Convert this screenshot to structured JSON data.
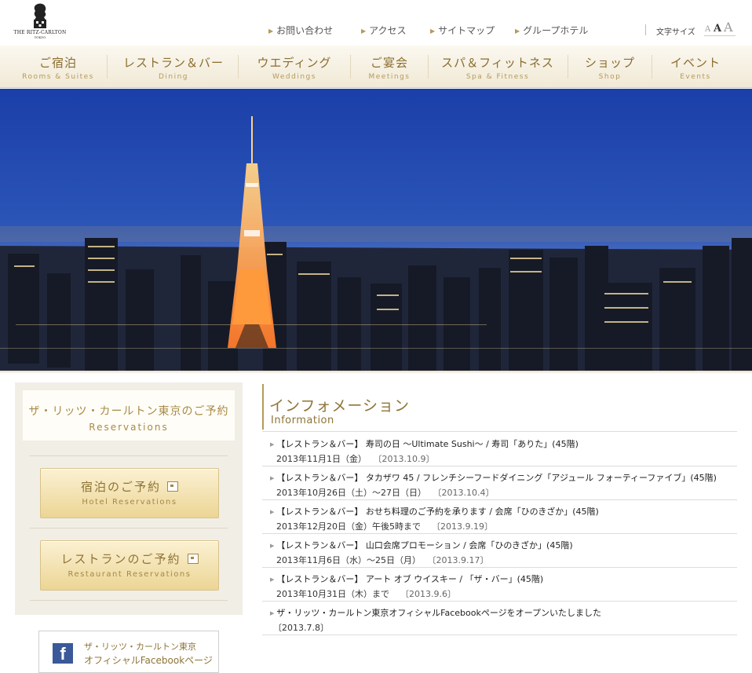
{
  "brand": {
    "wordmark": "THE RITZ-CARLTON",
    "city": "TOKYO"
  },
  "utility_links": [
    "お問い合わせ",
    "アクセス",
    "サイトマップ",
    "グループホテル"
  ],
  "font_size": {
    "label": "文字サイズ",
    "small": "A",
    "medium": "A",
    "large": "A"
  },
  "nav": [
    {
      "jp": "ご宿泊",
      "en": "Rooms & Suites"
    },
    {
      "jp": "レストラン＆バー",
      "en": "Dining"
    },
    {
      "jp": "ウエディング",
      "en": "Weddings"
    },
    {
      "jp": "ご宴会",
      "en": "Meetings"
    },
    {
      "jp": "スパ＆フィットネス",
      "en": "Spa & Fitness"
    },
    {
      "jp": "ショップ",
      "en": "Shop"
    },
    {
      "jp": "イベント",
      "en": "Events"
    }
  ],
  "reservations": {
    "title_jp": "ザ・リッツ・カールトン東京のご予約",
    "title_en": "Reservations",
    "hotel": {
      "jp": "宿泊のご予約",
      "en": "Hotel Reservations"
    },
    "restaurant": {
      "jp": "レストランのご予約",
      "en": "Restaurant Reservations"
    }
  },
  "facebook": {
    "icon": "f",
    "line1": "ザ・リッツ・カールトン東京",
    "line2": "オフィシャルFacebookページ"
  },
  "information": {
    "title_jp": "インフォメーション",
    "title_en": "Information",
    "items": [
      {
        "title": "【レストラン＆バー】 寿司の日 ～Ultimate Sushi～ / 寿司「ありた」(45階)",
        "detail": "2013年11月1日（金）",
        "date": "〔2013.10.9〕"
      },
      {
        "title": "【レストラン＆バー】 タカザワ 45 / フレンチシーフードダイニング「アジュール フォーティーファイブ」(45階)",
        "detail": "2013年10月26日（土）～27日（日）",
        "date": "〔2013.10.4〕"
      },
      {
        "title": "【レストラン＆バー】 おせち料理のご予約を承ります / 会席「ひのきざか」(45階)",
        "detail": "2013年12月20日（金）午後5時まで",
        "date": "〔2013.9.19〕"
      },
      {
        "title": "【レストラン＆バー】 山口会席プロモーション / 会席「ひのきざか」(45階)",
        "detail": "2013年11月6日（水）～25日（月）",
        "date": "〔2013.9.17〕"
      },
      {
        "title": "【レストラン＆バー】 アート オブ ウイスキー / 「ザ・バー」(45階)",
        "detail": "2013年10月31日（木）まで",
        "date": "〔2013.9.6〕"
      },
      {
        "title": "ザ・リッツ・カールトン東京オフィシャルFacebookページをオープンいたしました",
        "detail": "",
        "date": "〔2013.7.8〕"
      }
    ]
  },
  "colors": {
    "gold": "#8e7437",
    "nav_bg": "#f1e9d6",
    "facebook": "#3b5998",
    "sky": "#2a4fb0"
  }
}
